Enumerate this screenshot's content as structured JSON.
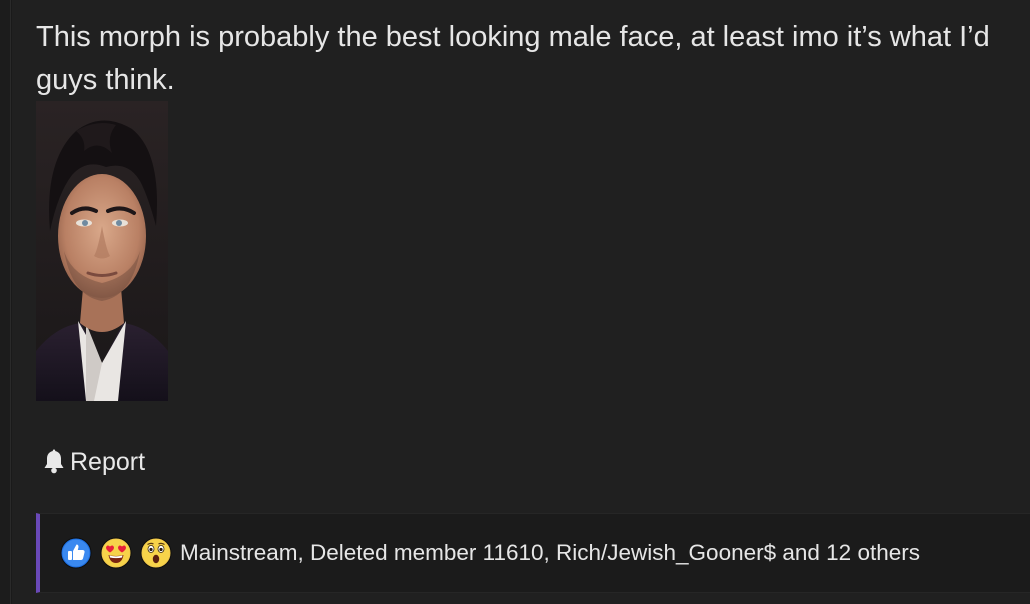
{
  "post": {
    "text_line1": "This morph is probably the best looking male face, at least imo it’s what I’d",
    "text_line2": "guys think."
  },
  "attachment": {
    "icon": "morph-face-image"
  },
  "actions": {
    "report_label": "Report",
    "report_icon": "bell-icon"
  },
  "reactions": {
    "icons": [
      "like-icon",
      "love-icon",
      "wow-icon"
    ],
    "summary": "Mainstream, Deleted member 11610, Rich/Jewish_Gooner$ and 12 others",
    "accent_color": "#6a49b8"
  }
}
